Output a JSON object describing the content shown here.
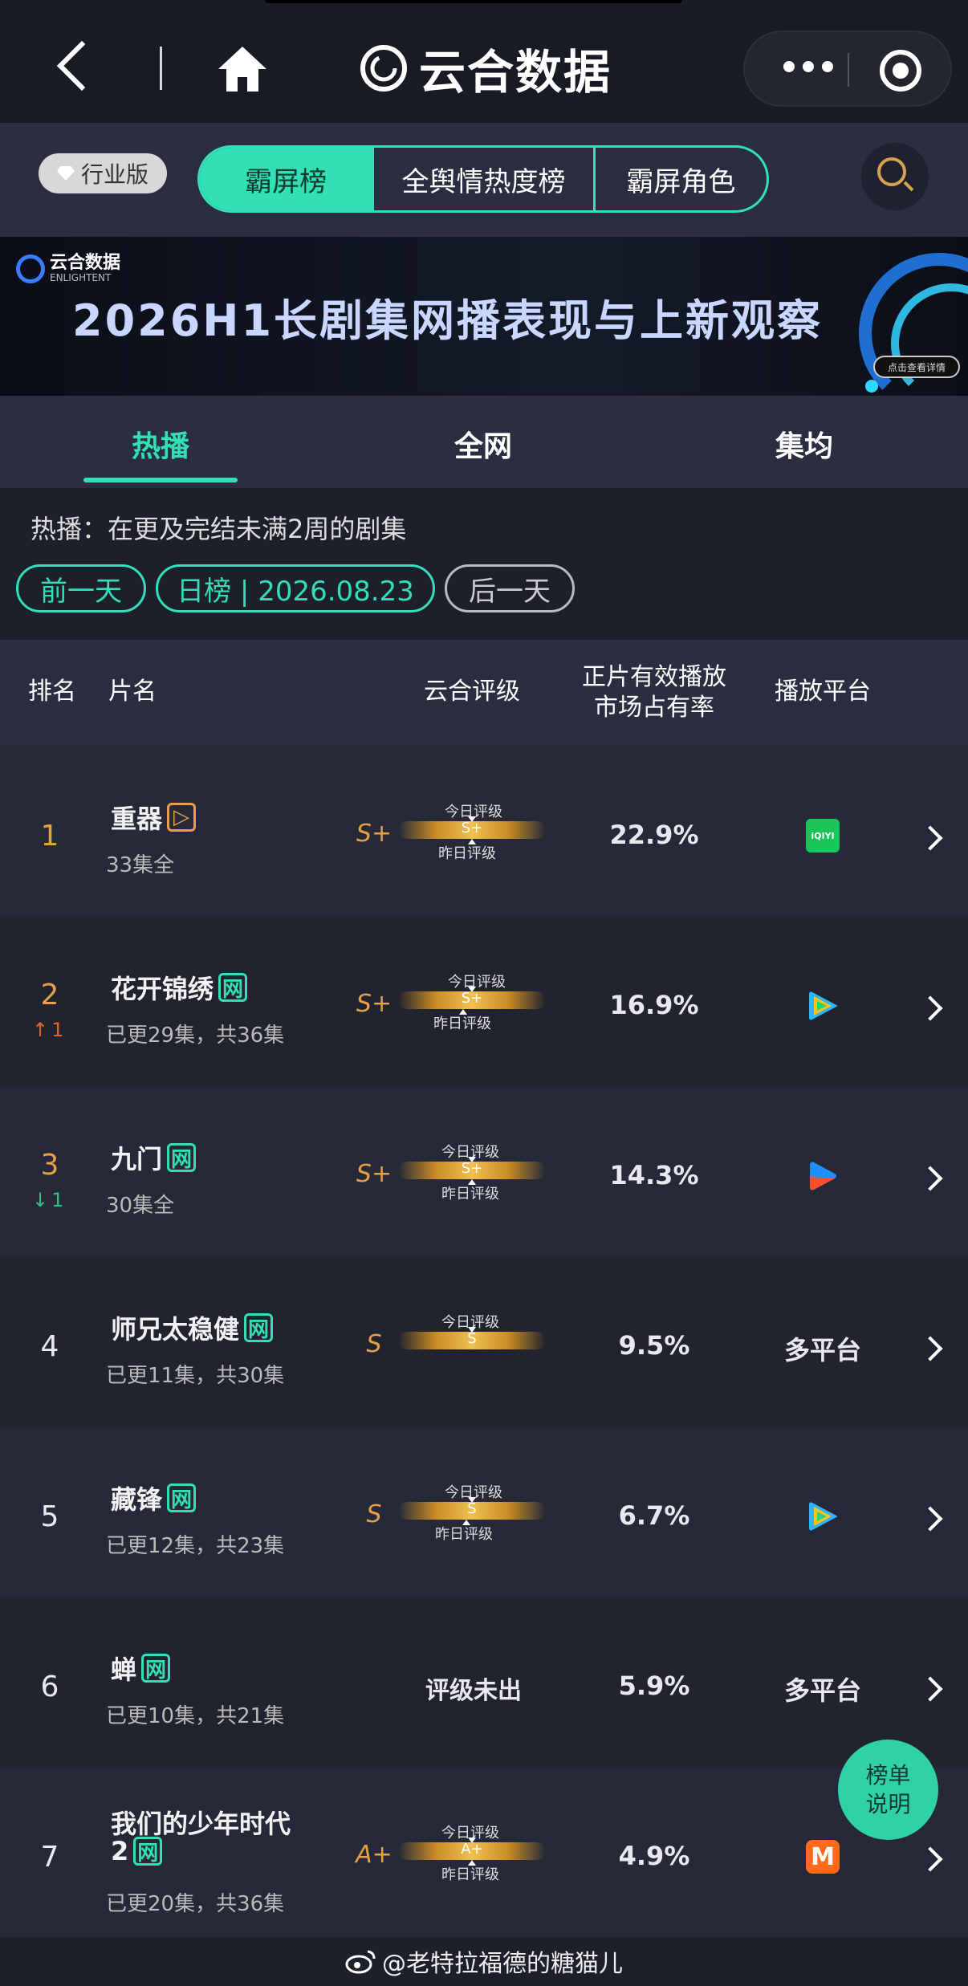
{
  "nav": {
    "app_name": "云合数据",
    "capsule_icons": [
      "more-dots-icon",
      "close-target-icon"
    ]
  },
  "tabrow": {
    "badge": "行业版",
    "segments": [
      "霸屏榜",
      "全舆情热度榜",
      "霸屏角色"
    ],
    "active_segment": "霸屏榜"
  },
  "banner": {
    "logo_text": "云合数据",
    "logo_sub": "ENLIGHTENT",
    "title": "2026H1长剧集网播表现与上新观察",
    "cta": "点击查看详情"
  },
  "subtabs": {
    "items": [
      "热播",
      "全网",
      "集均"
    ],
    "active": "热播"
  },
  "description": "热播：在更及完结未满2周的剧集",
  "date_nav": {
    "prev": "前一天",
    "current": "日榜 | 2026.08.23",
    "next": "后一天"
  },
  "table": {
    "headers": {
      "rank": "排名",
      "title": "片名",
      "grade": "云合评级",
      "share_line1": "正片有效播放",
      "share_line2": "市场占有率",
      "platform": "播放平台"
    },
    "gauge_today": "今日评级",
    "gauge_yesterday": "昨日评级",
    "rows": [
      {
        "rank": "1",
        "title": "重器",
        "tag": "▷",
        "episodes": "33集全",
        "grade": "S+",
        "gauge": "S+",
        "change": "",
        "share": "22.9%",
        "platform": "爱奇艺",
        "platform_icon": "iqiyi-icon",
        "platform_label": "iQIYI"
      },
      {
        "rank": "2",
        "title": "花开锦绣",
        "tag": "网",
        "episodes": "已更29集，共36集",
        "grade": "S+",
        "gauge": "S+",
        "change": "1",
        "change_dir": "up",
        "share": "16.9%",
        "platform": "腾讯视频",
        "platform_icon": "tencent-video-icon"
      },
      {
        "rank": "3",
        "title": "九门",
        "tag": "网",
        "episodes": "30集全",
        "grade": "S+",
        "gauge": "S+",
        "change": "1",
        "change_dir": "down",
        "share": "14.3%",
        "platform": "优酷",
        "platform_icon": "youku-icon"
      },
      {
        "rank": "4",
        "title": "师兄太稳健",
        "tag": "网",
        "episodes": "已更11集，共30集",
        "grade": "S",
        "gauge": "S",
        "change": "",
        "share": "9.5%",
        "platform": "多平台",
        "platform_icon": ""
      },
      {
        "rank": "5",
        "title": "藏锋",
        "tag": "网",
        "episodes": "已更12集，共23集",
        "grade": "S",
        "gauge": "S",
        "change": "",
        "share": "6.7%",
        "platform": "腾讯视频",
        "platform_icon": "tencent-video-icon"
      },
      {
        "rank": "6",
        "title": "蝉",
        "tag": "网",
        "episodes": "已更10集，共21集",
        "grade": "",
        "gauge": "",
        "pending": "评级未出",
        "change": "",
        "share": "5.9%",
        "platform": "多平台",
        "platform_icon": ""
      },
      {
        "rank": "7",
        "title": "我们的少年时代",
        "title2": "2",
        "tag": "网",
        "episodes": "已更20集，共36集",
        "grade": "A+",
        "gauge": "A+",
        "change": "",
        "share": "4.9%",
        "platform": "芒果TV",
        "platform_icon": "mgtv-icon",
        "platform_label": "M"
      }
    ]
  },
  "fab": {
    "line1": "榜单",
    "line2": "说明"
  },
  "footer": "@老特拉福德的糖猫儿",
  "colors": {
    "accent": "#32e0b4",
    "gold": "#e8a046",
    "bg": "#1d1f2b"
  }
}
